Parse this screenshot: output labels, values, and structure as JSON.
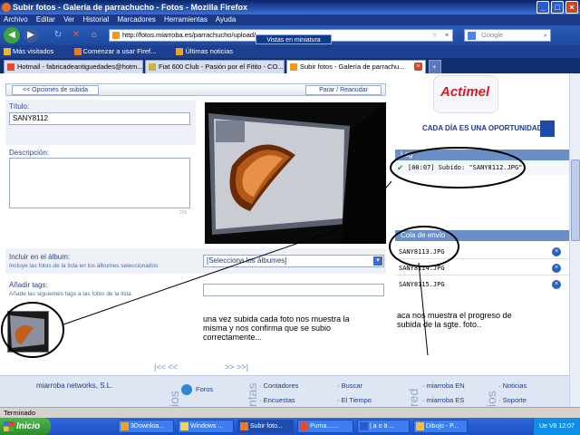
{
  "window": {
    "title": "Subir fotos - Galería de parrachucho - Fotos - Mozilla Firefox"
  },
  "menu": [
    "Archivo",
    "Editar",
    "Ver",
    "Historial",
    "Marcadores",
    "Herramientas",
    "Ayuda"
  ],
  "nav": {
    "url": "http://fotos.miarroba.es/parrachucho/upload/",
    "search_placeholder": "Google",
    "tooltip": "Vistas en miniatura"
  },
  "bookmarks": [
    "Más visitados",
    "Comenzar a usar Firef...",
    "Últimas noticias"
  ],
  "tabs": [
    {
      "label": "Hotmail - fabricadeantiguedades@hotm..."
    },
    {
      "label": "Fiat 600 Club - Pasión por el Fitito - CO..."
    },
    {
      "label": "Subir fotos - Galería de parrachu..."
    }
  ],
  "upload": {
    "back_label": "<< Opciones de subida",
    "stop_label": "Parar / Reanudar",
    "title_label": "Título:",
    "title_value": "SANY8112",
    "desc_label": "Descripción:",
    "desc_counter": "255",
    "album_label": "Incluir en el álbum:",
    "album_sub": "Incluye las fotos de la lista en los álbumes seleccionados",
    "album_select": "[Selecciona los álbumes]",
    "tags_label": "Añadir tags:",
    "tags_sub": "Añade las siguientes tags a las fotos de la lista",
    "pager_prev": "|<< <<",
    "pager_next": ">> >>|"
  },
  "ad": {
    "brand": "Actimel",
    "slogan": "CADA DÍA ES UNA OPORTUNIDAD."
  },
  "log": {
    "header": "Log",
    "entry": "[00:07] Subido: \"SANY8112.JPG\""
  },
  "queue": {
    "header": "Cola de envío",
    "files": [
      "SANY8113.JPG",
      "SANY8114.JPG",
      "SANY8115.JPG"
    ]
  },
  "annotations": {
    "left": "una vez subida cada foto nos muestra la misma y nos confirma que se subio correctamente...",
    "right": "aca nos muestra el progreso de subida de la sgte. foto.."
  },
  "footer": {
    "company": "miarroba networks, S.L.",
    "section1": "Foros",
    "section1_vertical": "ios",
    "section2_vertical": "ntas",
    "section3_vertical": "red",
    "section4_vertical": "ios",
    "col1": [
      "Contadores",
      "Encuestas"
    ],
    "col2": [
      "Buscar",
      "El Tiempo"
    ],
    "col3": [
      "miarroba EN",
      "miarroba ES"
    ],
    "col4": [
      "Noticias",
      "Soporte"
    ]
  },
  "status": "Terminado",
  "taskbar": {
    "start": "Inicio",
    "items": [
      "3Downloa...",
      "Windows ...",
      "Subir foto...",
      "Puma.......",
      "| a o ä ...",
      "Dibujo - P..."
    ],
    "tray": "Ue V8  12:07"
  }
}
